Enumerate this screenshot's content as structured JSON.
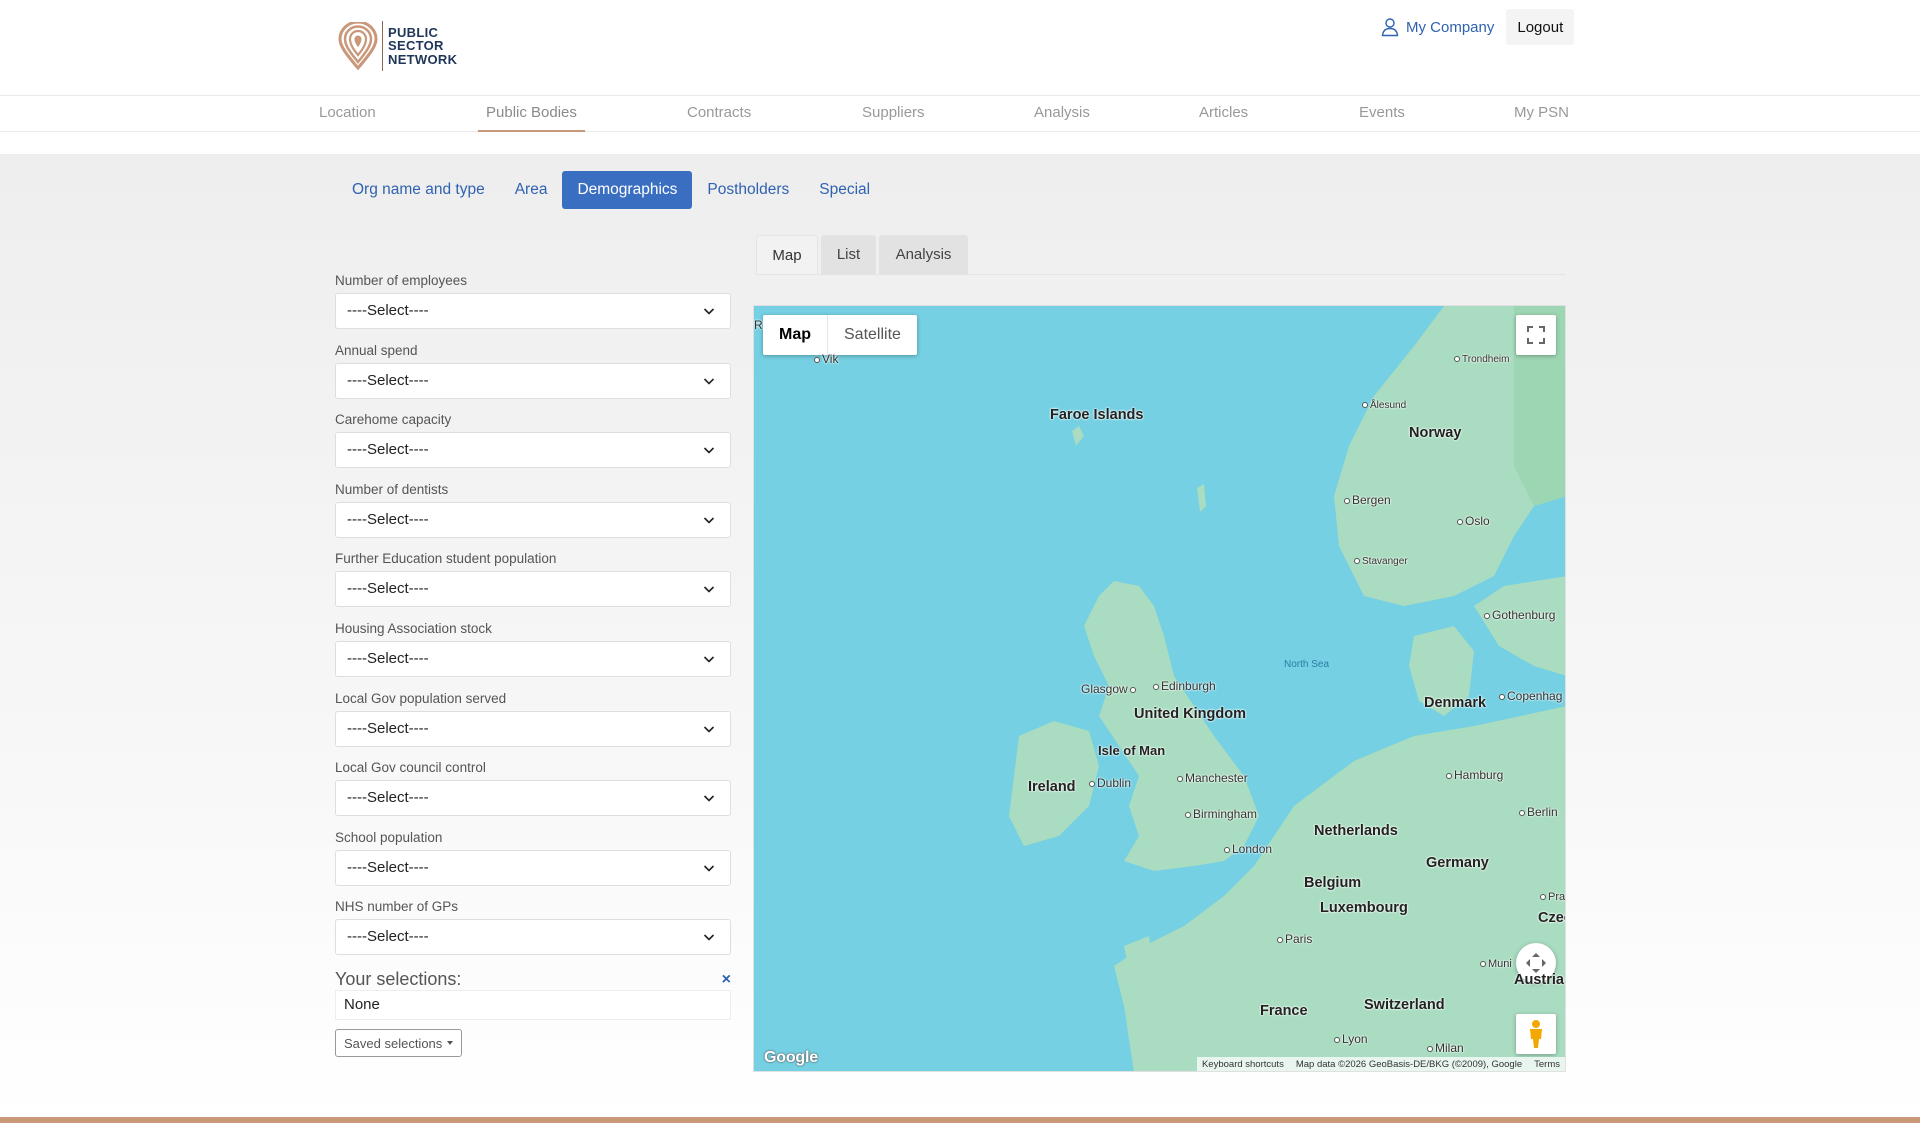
{
  "brand": {
    "logo_lines": [
      "PUBLIC",
      "SECTOR",
      "NETWORK"
    ]
  },
  "top_right": {
    "account_label": "My Company",
    "logout_label": "Logout"
  },
  "main_nav": {
    "items": [
      "Location",
      "Public Bodies",
      "Contracts",
      "Suppliers",
      "Analysis",
      "Articles",
      "Events",
      "My PSN"
    ],
    "active": "Public Bodies"
  },
  "sub_tabs": {
    "items": [
      "Org name and type",
      "Area",
      "Demographics",
      "Postholders",
      "Special"
    ],
    "active": "Demographics"
  },
  "filters": {
    "placeholder": "----Select----",
    "fields": [
      "Number of employees",
      "Annual spend",
      "Carehome capacity",
      "Number of dentists",
      "Further Education student population",
      "Housing Association stock",
      "Local Gov population served",
      "Local Gov council control",
      "School population",
      "NHS number of GPs"
    ]
  },
  "selections": {
    "title": "Your selections:",
    "close_symbol": "×",
    "value": "None",
    "saved_label": "Saved selections"
  },
  "view_tabs": {
    "items": [
      "Map",
      "List",
      "Analysis"
    ],
    "active": "Map"
  },
  "map": {
    "map_type": [
      "Map",
      "Satellite"
    ],
    "active_type": "Map",
    "colors": {
      "sea": "#74d0e2",
      "land": "#a9dcc0",
      "land_dark": "#8fcfa8"
    },
    "countries": [
      "Faroe Islands",
      "Norway",
      "Denmark",
      "United Kingdom",
      "Ireland",
      "Isle of Man",
      "Netherlands",
      "Germany",
      "Belgium",
      "Luxembourg",
      "France",
      "Switzerland",
      "Austria",
      "Czec"
    ],
    "cities": [
      "Vik",
      "Trondheim",
      "Ålesund",
      "Bergen",
      "Oslo",
      "Stavanger",
      "Gothenburg",
      "Copenhag",
      "Glasgow",
      "Edinburgh",
      "Dublin",
      "Manchester",
      "Birmingham",
      "London",
      "Hamburg",
      "Berlin",
      "Paris",
      "Pra",
      "Muni",
      "Lyon",
      "Milan",
      "R"
    ],
    "sea_label": "North Sea",
    "google_logo": "Google",
    "attribution": {
      "shortcuts": "Keyboard shortcuts",
      "data": "Map data ©2026 GeoBasis-DE/BKG (©2009), Google",
      "terms": "Terms"
    },
    "icons": [
      "fullscreen-icon",
      "camera-control-icon",
      "pegman-icon"
    ]
  }
}
